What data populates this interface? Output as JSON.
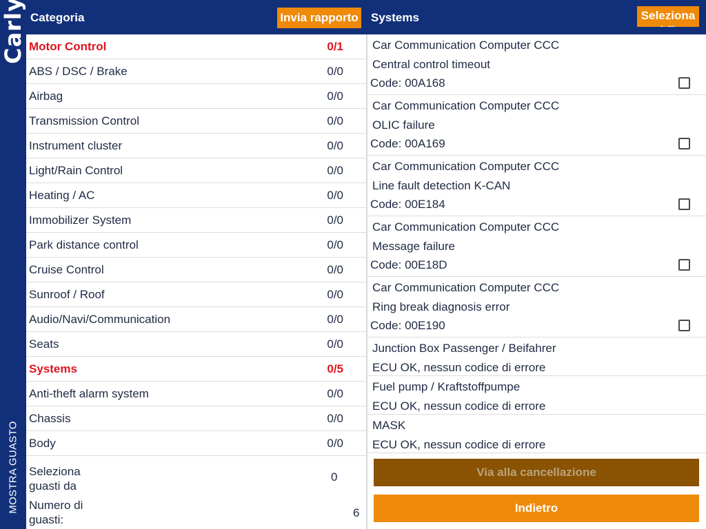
{
  "brand": {
    "logo_text": "Carly",
    "mode_label": "MOSTRA GUASTO"
  },
  "header": {
    "left_title": "Categoria",
    "send_report_label": "Invia rapporto",
    "right_title": "Systems",
    "select_all_label": "Seleziona",
    "select_all_sub": "tutti"
  },
  "categories": [
    {
      "name": "Motor Control",
      "count": "0/1",
      "alert": true
    },
    {
      "name": "ABS / DSC / Brake",
      "count": "0/0",
      "alert": false
    },
    {
      "name": "Airbag",
      "count": "0/0",
      "alert": false
    },
    {
      "name": "Transmission Control",
      "count": "0/0",
      "alert": false
    },
    {
      "name": "Instrument cluster",
      "count": "0/0",
      "alert": false
    },
    {
      "name": "Light/Rain Control",
      "count": "0/0",
      "alert": false
    },
    {
      "name": "Heating / AC",
      "count": "0/0",
      "alert": false
    },
    {
      "name": "Immobilizer System",
      "count": "0/0",
      "alert": false
    },
    {
      "name": "Park distance control",
      "count": "0/0",
      "alert": false
    },
    {
      "name": "Cruise Control",
      "count": "0/0",
      "alert": false
    },
    {
      "name": "Sunroof / Roof",
      "count": "0/0",
      "alert": false
    },
    {
      "name": "Audio/Navi/Communication",
      "count": "0/0",
      "alert": false
    },
    {
      "name": "Seats",
      "count": "0/0",
      "alert": false
    },
    {
      "name": "Systems",
      "count": "0/5",
      "alert": true
    },
    {
      "name": "Anti-theft alarm system",
      "count": "0/0",
      "alert": false
    },
    {
      "name": "Chassis",
      "count": "0/0",
      "alert": false
    },
    {
      "name": "Body",
      "count": "0/0",
      "alert": false
    }
  ],
  "summary": {
    "selected_label_1": "Seleziona",
    "selected_label_2": "guasti da",
    "selected_value": "0",
    "count_label_1": "Numero di",
    "count_label_2": "guasti:",
    "count_value": "6"
  },
  "errors": [
    {
      "module": "Car Communication Computer CCC",
      "description": "Central control timeout",
      "code": "Code:  00A168",
      "checked": false
    },
    {
      "module": "Car Communication Computer CCC",
      "description": "OLIC failure",
      "code": "Code:  00A169",
      "checked": false
    },
    {
      "module": "Car Communication Computer CCC",
      "description": "Line fault detection K-CAN",
      "code": "Code:  00E184",
      "checked": false
    },
    {
      "module": "Car Communication Computer CCC",
      "description": "Message failure",
      "code": "Code:  00E18D",
      "checked": false
    },
    {
      "module": "Car Communication Computer CCC",
      "description": "Ring break diagnosis error",
      "code": "Code:  00E190",
      "checked": false
    }
  ],
  "ok_modules": [
    {
      "module": "Junction Box Passenger / Beifahrer",
      "status": "ECU OK, nessun codice di errore"
    },
    {
      "module": "Fuel pump / Kraftstoffpumpe",
      "status": "ECU OK, nessun codice di errore"
    },
    {
      "module": "MASK",
      "status": "ECU OK, nessun codice di errore"
    }
  ],
  "buttons": {
    "clear_label": "Via alla cancellazione",
    "back_label": "Indietro"
  },
  "colors": {
    "brand_blue": "#12307a",
    "accent_orange": "#ef8a0b",
    "alert_red": "#e0141e",
    "disabled_brown": "#8a5203"
  }
}
